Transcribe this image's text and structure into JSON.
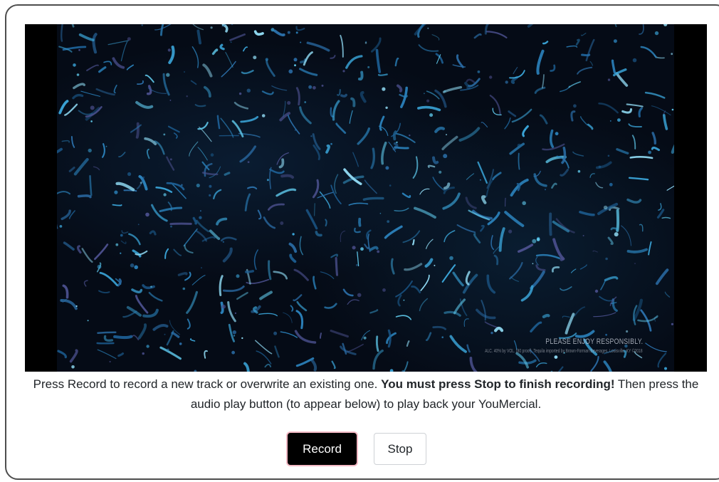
{
  "video": {
    "disclaimer": "PLEASE ENJOY RESPONSIBLY.",
    "fine_print": "ALC. 40% by VOL. (80 proof). Tequila imported by Brown-Forman Beverages, Louisville, KY ©2018"
  },
  "instructions": {
    "part1": "Press Record to record a new track or overwrite an existing one. ",
    "bold": "You must press Stop to finish recording!",
    "part2": " Then press the audio play button (to appear below) to play back your YouMercial."
  },
  "controls": {
    "record_label": "Record",
    "stop_label": "Stop"
  },
  "colors": {
    "record_bg": "#000000",
    "record_ring": "#f3b9c4",
    "card_border": "#4e4e4e"
  }
}
